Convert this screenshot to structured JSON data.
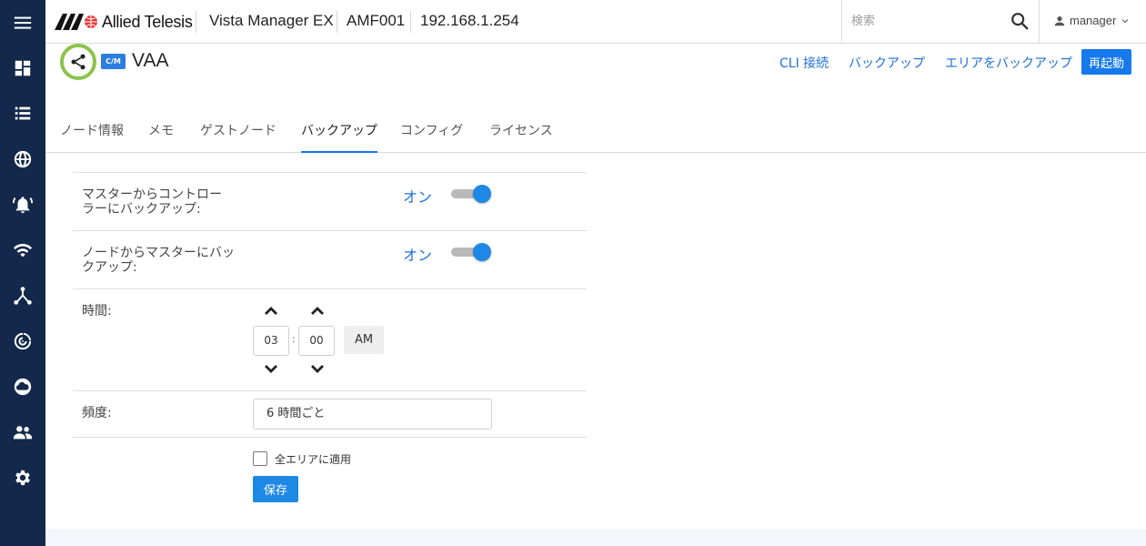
{
  "topbar": {
    "brand": "Allied Telesis",
    "product": "Vista Manager EX",
    "area": "AMF001",
    "ip": "192.168.1.254",
    "search_placeholder": "検索",
    "user": "manager"
  },
  "sidebar": {
    "items": [
      "menu-icon",
      "dashboard-icon",
      "list-icon",
      "globe-icon",
      "alarm-icon",
      "wifi-icon",
      "topology-icon",
      "radar-icon",
      "cloud-icon",
      "users-icon",
      "settings-icon"
    ]
  },
  "header": {
    "cm_badge": "C/M",
    "node_name": "VAA",
    "actions": {
      "cli": "CLI 接続",
      "backup": "バックアップ",
      "area_backup": "エリアをバックアップ",
      "restart": "再起動"
    },
    "tabs": [
      "ノード情報",
      "メモ",
      "ゲストノード",
      "バックアップ",
      "コンフィグ",
      "ライセンス"
    ],
    "active_tab": "バックアップ"
  },
  "settings": {
    "master_to_controller": {
      "label_line1": "マスターからコントロー",
      "label_line2": "ラーにバックアップ:",
      "state": "オン",
      "on": true
    },
    "node_to_master": {
      "label_line1": "ノードからマスターにバッ",
      "label_line2": "クアップ:",
      "state": "オン",
      "on": true
    },
    "time": {
      "label": "時間:",
      "hour": "03",
      "minute": "00",
      "ampm": "AM"
    },
    "frequency": {
      "label": "頻度:",
      "value": "6 時間ごと"
    },
    "apply_all": {
      "label": "全エリアに適用",
      "checked": false
    },
    "save": "保存"
  },
  "colors": {
    "sidebar": "#13284a",
    "accent": "#1679ec",
    "link": "#1e6fd9",
    "node_ring": "#8bc34a"
  }
}
